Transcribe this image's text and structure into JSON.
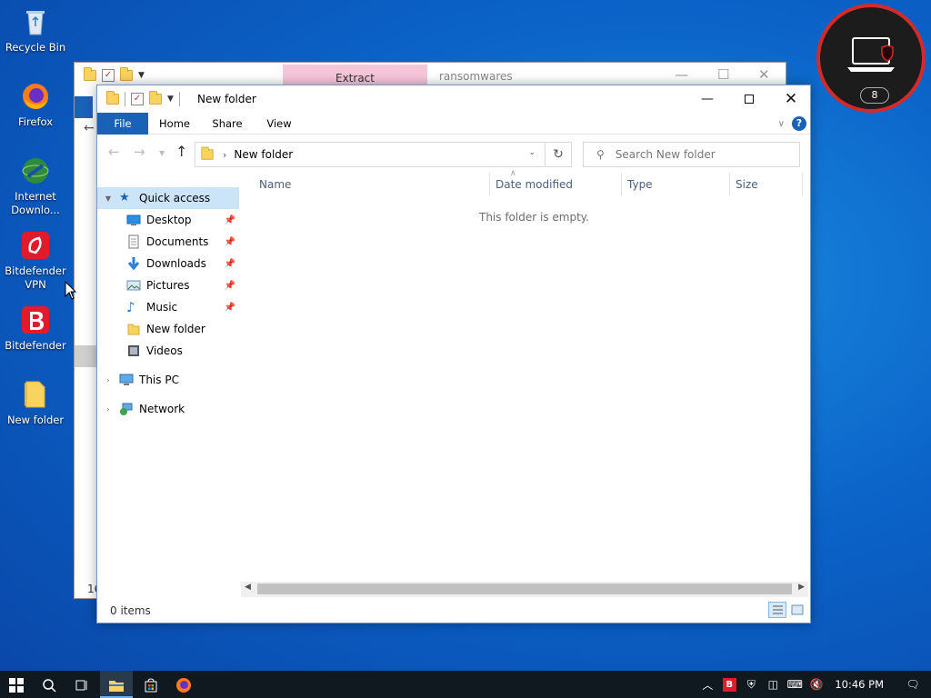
{
  "desktop": {
    "icons": [
      {
        "label": "Recycle Bin",
        "icon": "recycle-bin-icon"
      },
      {
        "label": "Firefox",
        "icon": "firefox-icon"
      },
      {
        "label": "Internet Downlo...",
        "icon": "internet-download-manager-icon"
      },
      {
        "label": "Bitdefender VPN",
        "icon": "bitdefender-vpn-icon"
      },
      {
        "label": "Bitdefender",
        "icon": "bitdefender-icon"
      },
      {
        "label": "New folder",
        "icon": "folder-icon"
      }
    ]
  },
  "back_window": {
    "tab_label": "Extract",
    "title": "ransomwares",
    "status_fragment": "16"
  },
  "window": {
    "title": "New folder",
    "ribbon_tabs": {
      "file": "File",
      "home": "Home",
      "share": "Share",
      "view": "View"
    },
    "address": {
      "path": "New folder"
    },
    "search": {
      "placeholder": "Search New folder"
    },
    "nav": {
      "quick_access": "Quick access",
      "items": [
        {
          "label": "Desktop",
          "pinned": true
        },
        {
          "label": "Documents",
          "pinned": true
        },
        {
          "label": "Downloads",
          "pinned": true
        },
        {
          "label": "Pictures",
          "pinned": true
        },
        {
          "label": "Music",
          "pinned": true
        },
        {
          "label": "New folder",
          "pinned": false
        },
        {
          "label": "Videos",
          "pinned": false
        }
      ],
      "this_pc": "This PC",
      "network": "Network"
    },
    "columns": {
      "name": "Name",
      "date_modified": "Date modified",
      "type": "Type",
      "size": "Size"
    },
    "empty_message": "This folder is empty.",
    "status": "0 items"
  },
  "bitdefender_widget": {
    "count": "8"
  },
  "taskbar": {
    "clock": "10:46 PM"
  },
  "colors": {
    "accent": "#1a62b8",
    "selection": "#cce4f7",
    "bitdefender_red": "#d42a2a"
  }
}
